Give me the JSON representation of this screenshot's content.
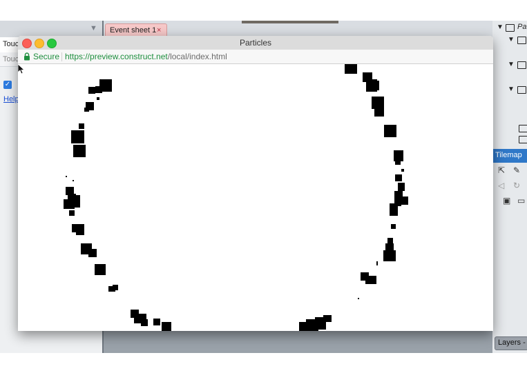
{
  "editor": {
    "left_panel": {
      "row1_text": "Touc",
      "row2_text": "Touc",
      "checkbox_mark": "✓",
      "help_link": "Help"
    },
    "event_tab": {
      "label": "Event sheet 1",
      "close": "×"
    },
    "right_panel": {
      "tree_label": "Pa",
      "tilemap_header": "Tilemap",
      "layers_tab": "Layers -"
    }
  },
  "preview_window": {
    "title": "Particles",
    "secure_label": "Secure",
    "url_host": "https://preview.construct.net",
    "url_path": "/local/index.html"
  },
  "colors": {
    "secure_green": "#1e8e3e",
    "tilemap_blue": "#2f78c8",
    "tab_pink": "#f6c8c8",
    "particle": "#000000"
  },
  "icons": [
    "lock-icon",
    "cursor-icon",
    "folder-icon",
    "pointer-tool-icon",
    "pencil-tool-icon",
    "save-icon",
    "close-icon"
  ]
}
